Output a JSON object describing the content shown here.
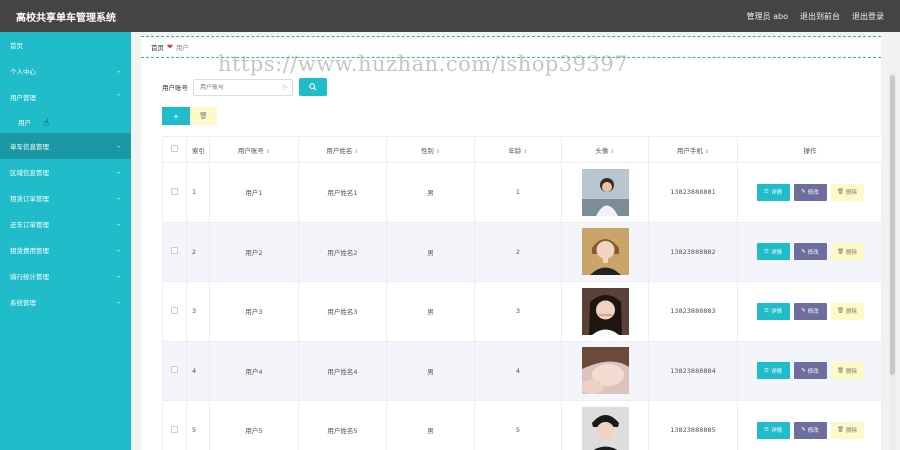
{
  "app": {
    "title": "高校共享单车管理系统"
  },
  "topbar": {
    "admin": "管理员 abo",
    "back": "退出到前台",
    "logout": "退出登录"
  },
  "sidebar": {
    "items": [
      {
        "label": "首页",
        "chevron": ""
      },
      {
        "label": "个人中心",
        "chevron": "⌄"
      },
      {
        "label": "用户管理",
        "chevron": "⌃"
      },
      {
        "label": "用户",
        "chevron": ""
      },
      {
        "label": "单车信息管理",
        "chevron": "⌄"
      },
      {
        "label": "区域信息管理",
        "chevron": "⌄"
      },
      {
        "label": "租赁订单管理",
        "chevron": "⌄"
      },
      {
        "label": "还车订单管理",
        "chevron": "⌄"
      },
      {
        "label": "租赁费用管理",
        "chevron": "⌄"
      },
      {
        "label": "骑行统计管理",
        "chevron": "⌄"
      },
      {
        "label": "系统管理",
        "chevron": "⌄"
      }
    ]
  },
  "breadcrumb": {
    "home": "首页",
    "current": "用户"
  },
  "watermark": "https://www.huzhan.com/ishop39397",
  "search": {
    "label": "用户账号",
    "placeholder": "用户账号"
  },
  "table": {
    "headers": [
      "索引",
      "用户账号",
      "用户姓名",
      "性别",
      "年龄",
      "头像",
      "用户手机",
      "操作"
    ],
    "rows": [
      {
        "idx": "1",
        "account": "用户1",
        "name": "用户姓名1",
        "gender": "男",
        "age": "1",
        "phone": "13823888881"
      },
      {
        "idx": "2",
        "account": "用户2",
        "name": "用户姓名2",
        "gender": "男",
        "age": "2",
        "phone": "13823888882"
      },
      {
        "idx": "3",
        "account": "用户3",
        "name": "用户姓名3",
        "gender": "男",
        "age": "3",
        "phone": "13823888883"
      },
      {
        "idx": "4",
        "account": "用户4",
        "name": "用户姓名4",
        "gender": "男",
        "age": "4",
        "phone": "13823888884"
      },
      {
        "idx": "5",
        "account": "用户5",
        "name": "用户姓名5",
        "gender": "男",
        "age": "5",
        "phone": "13823888885"
      }
    ],
    "ops": {
      "detail": "详情",
      "edit": "修改",
      "remove": "删除"
    }
  },
  "colors": {
    "accent": "#21bcc9",
    "topbar": "#444444",
    "edit": "#6d6e9d",
    "delete": "#fff9c8"
  }
}
